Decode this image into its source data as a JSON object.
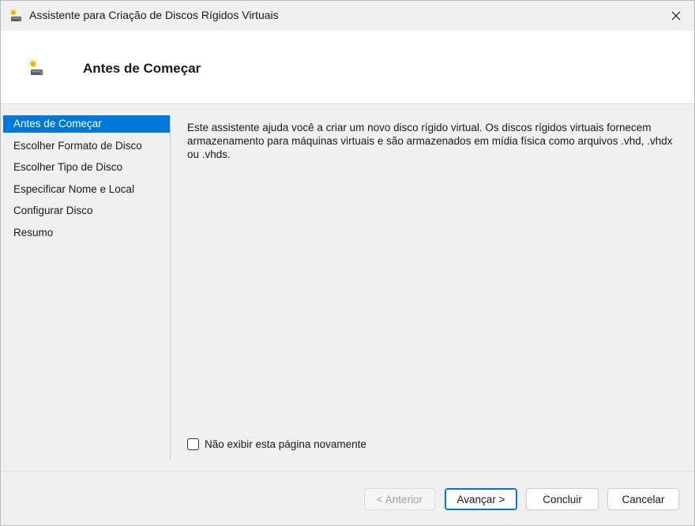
{
  "window": {
    "title": "Assistente para Criação de Discos Rígidos Virtuais"
  },
  "header": {
    "title": "Antes de Começar"
  },
  "nav": {
    "items": [
      {
        "label": "Antes de Começar",
        "active": true
      },
      {
        "label": "Escolher Formato de Disco",
        "active": false
      },
      {
        "label": "Escolher Tipo de Disco",
        "active": false
      },
      {
        "label": "Especificar Nome e Local",
        "active": false
      },
      {
        "label": "Configurar Disco",
        "active": false
      },
      {
        "label": "Resumo",
        "active": false
      }
    ]
  },
  "content": {
    "description": "Este assistente ajuda você a criar um novo disco rígido virtual. Os discos rígidos virtuais fornecem armazenamento para máquinas virtuais e são armazenados em mídia física como arquivos .vhd, .vhdx ou .vhds."
  },
  "options": {
    "dont_show_label": "Não exibir esta página novamente",
    "dont_show_checked": false
  },
  "buttons": {
    "previous": "< Anterior",
    "next": "Avançar >",
    "finish": "Concluir",
    "cancel": "Cancelar"
  },
  "colors": {
    "selection": "#0078d7",
    "window_bg": "#f0f0f0",
    "header_bg": "#ffffff"
  },
  "icons": {
    "app": "virtual-disk-wizard-icon",
    "close": "close-icon"
  }
}
